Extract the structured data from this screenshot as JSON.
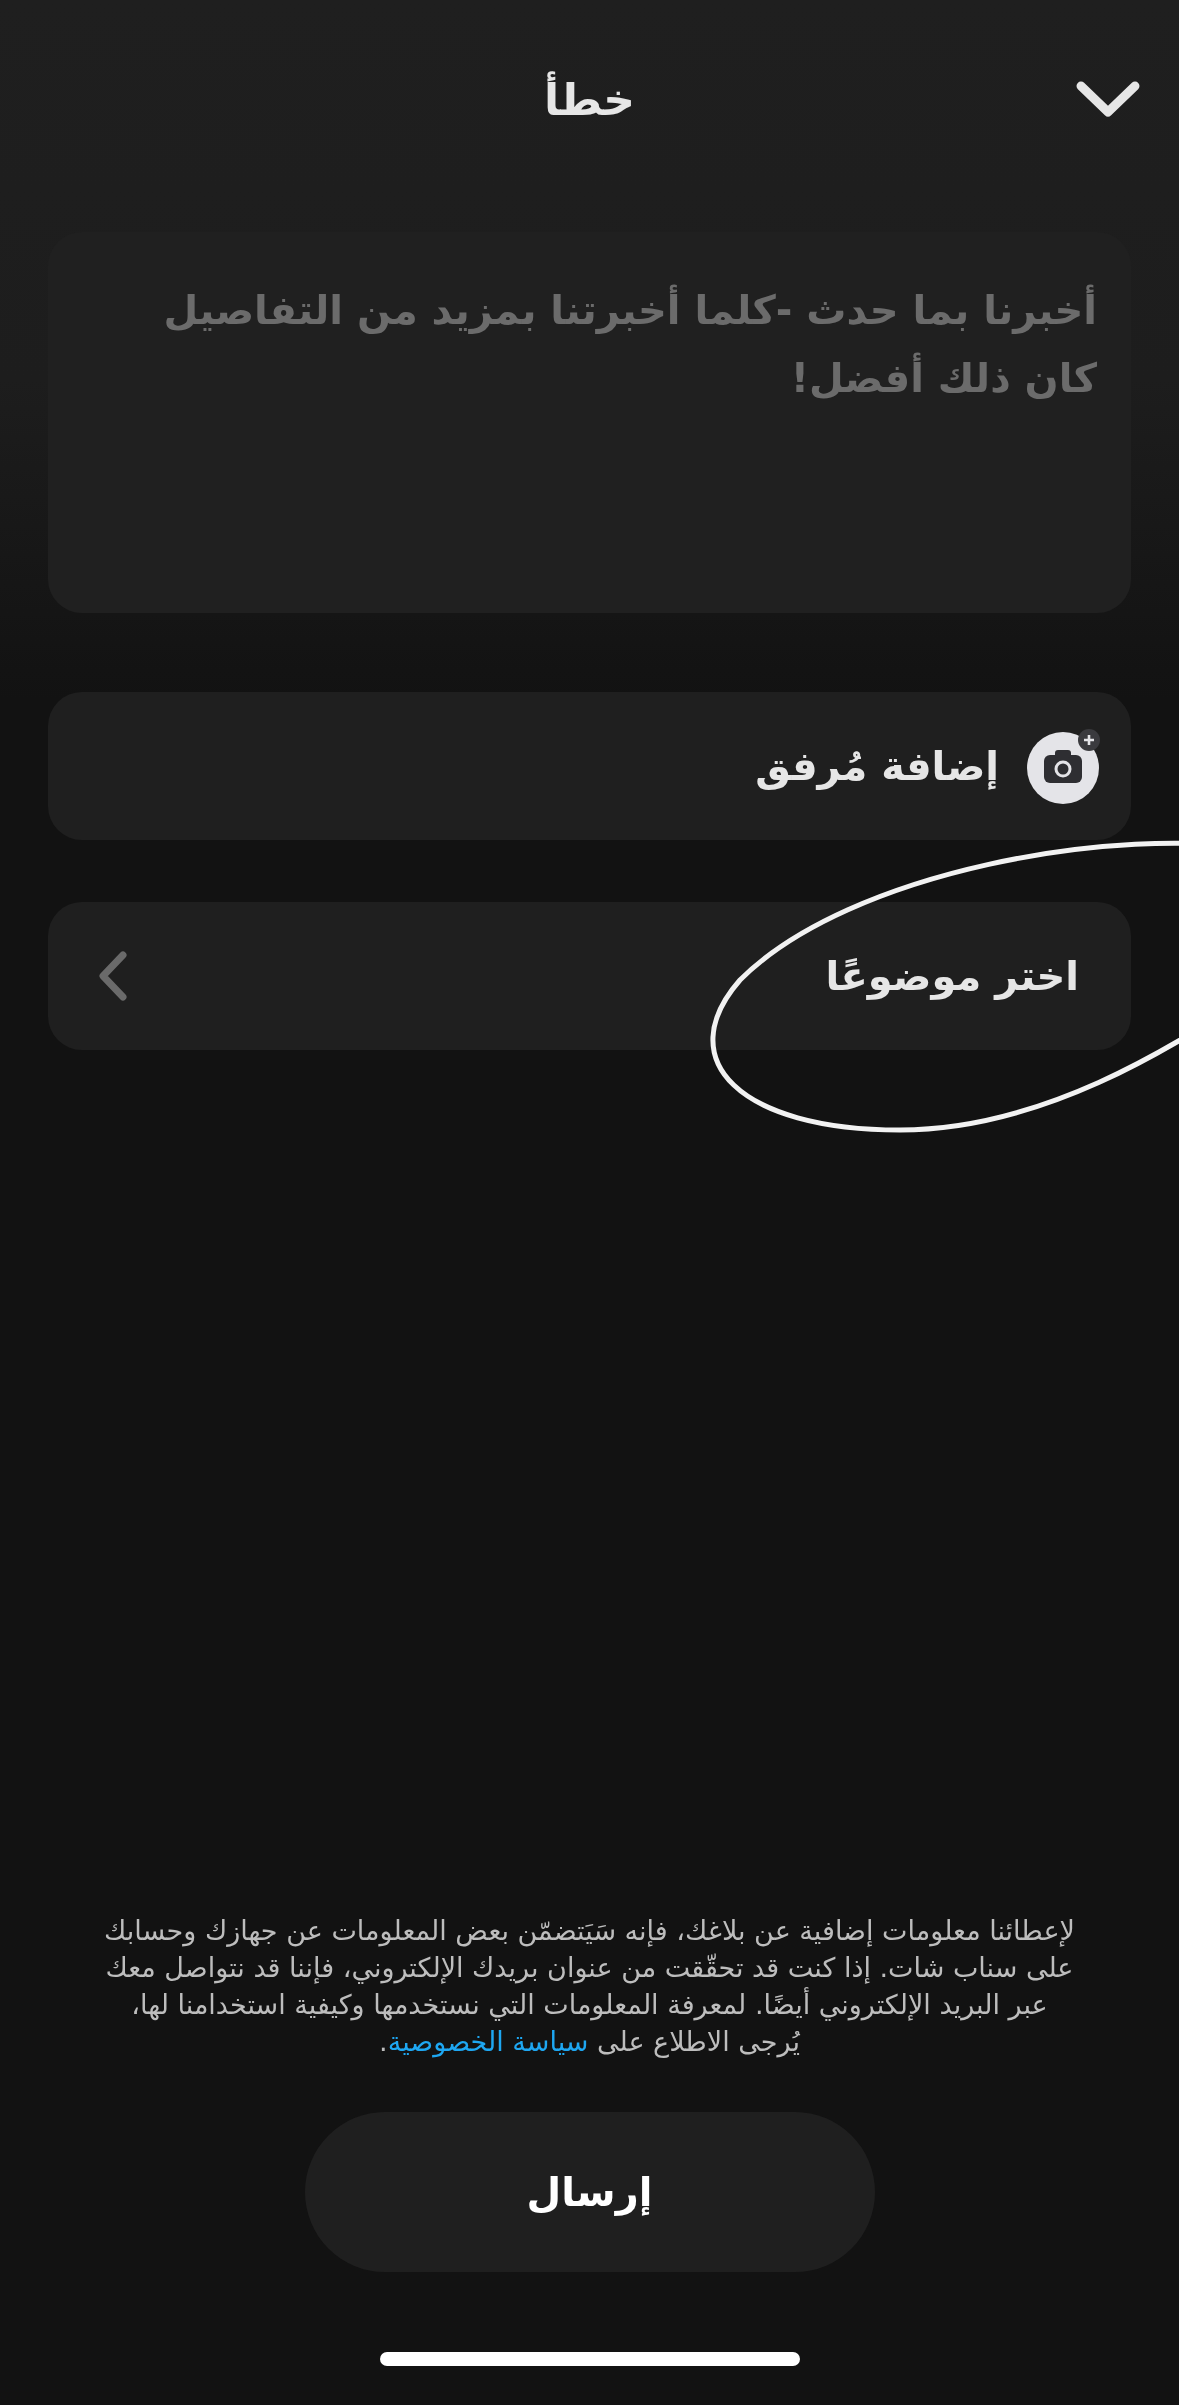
{
  "header": {
    "title": "خطأ"
  },
  "description": {
    "placeholder": "أخبرنا بما حدث -كلما أخبرتنا بمزيد من التفاصيل كان ذلك أفضل!"
  },
  "attachment": {
    "label": "إضافة مُرفق"
  },
  "topic": {
    "label": "اختر موضوعًا"
  },
  "notice": {
    "text": "لإعطائنا معلومات إضافية عن بلاغك، فإنه سَيَتضمّن بعض المعلومات عن جهازك وحسابك على سناب شات. إذا كنت قد تحقّقت من عنوان بريدك الإلكتروني، فإننا قد نتواصل معك عبر البريد الإلكتروني أيضًا. لمعرفة المعلومات التي نستخدمها وكيفية استخدامنا لها، يُرجى الاطلاع على ",
    "link": "سياسة الخصوصية",
    "after": "."
  },
  "submit": {
    "label": "إرسال"
  }
}
